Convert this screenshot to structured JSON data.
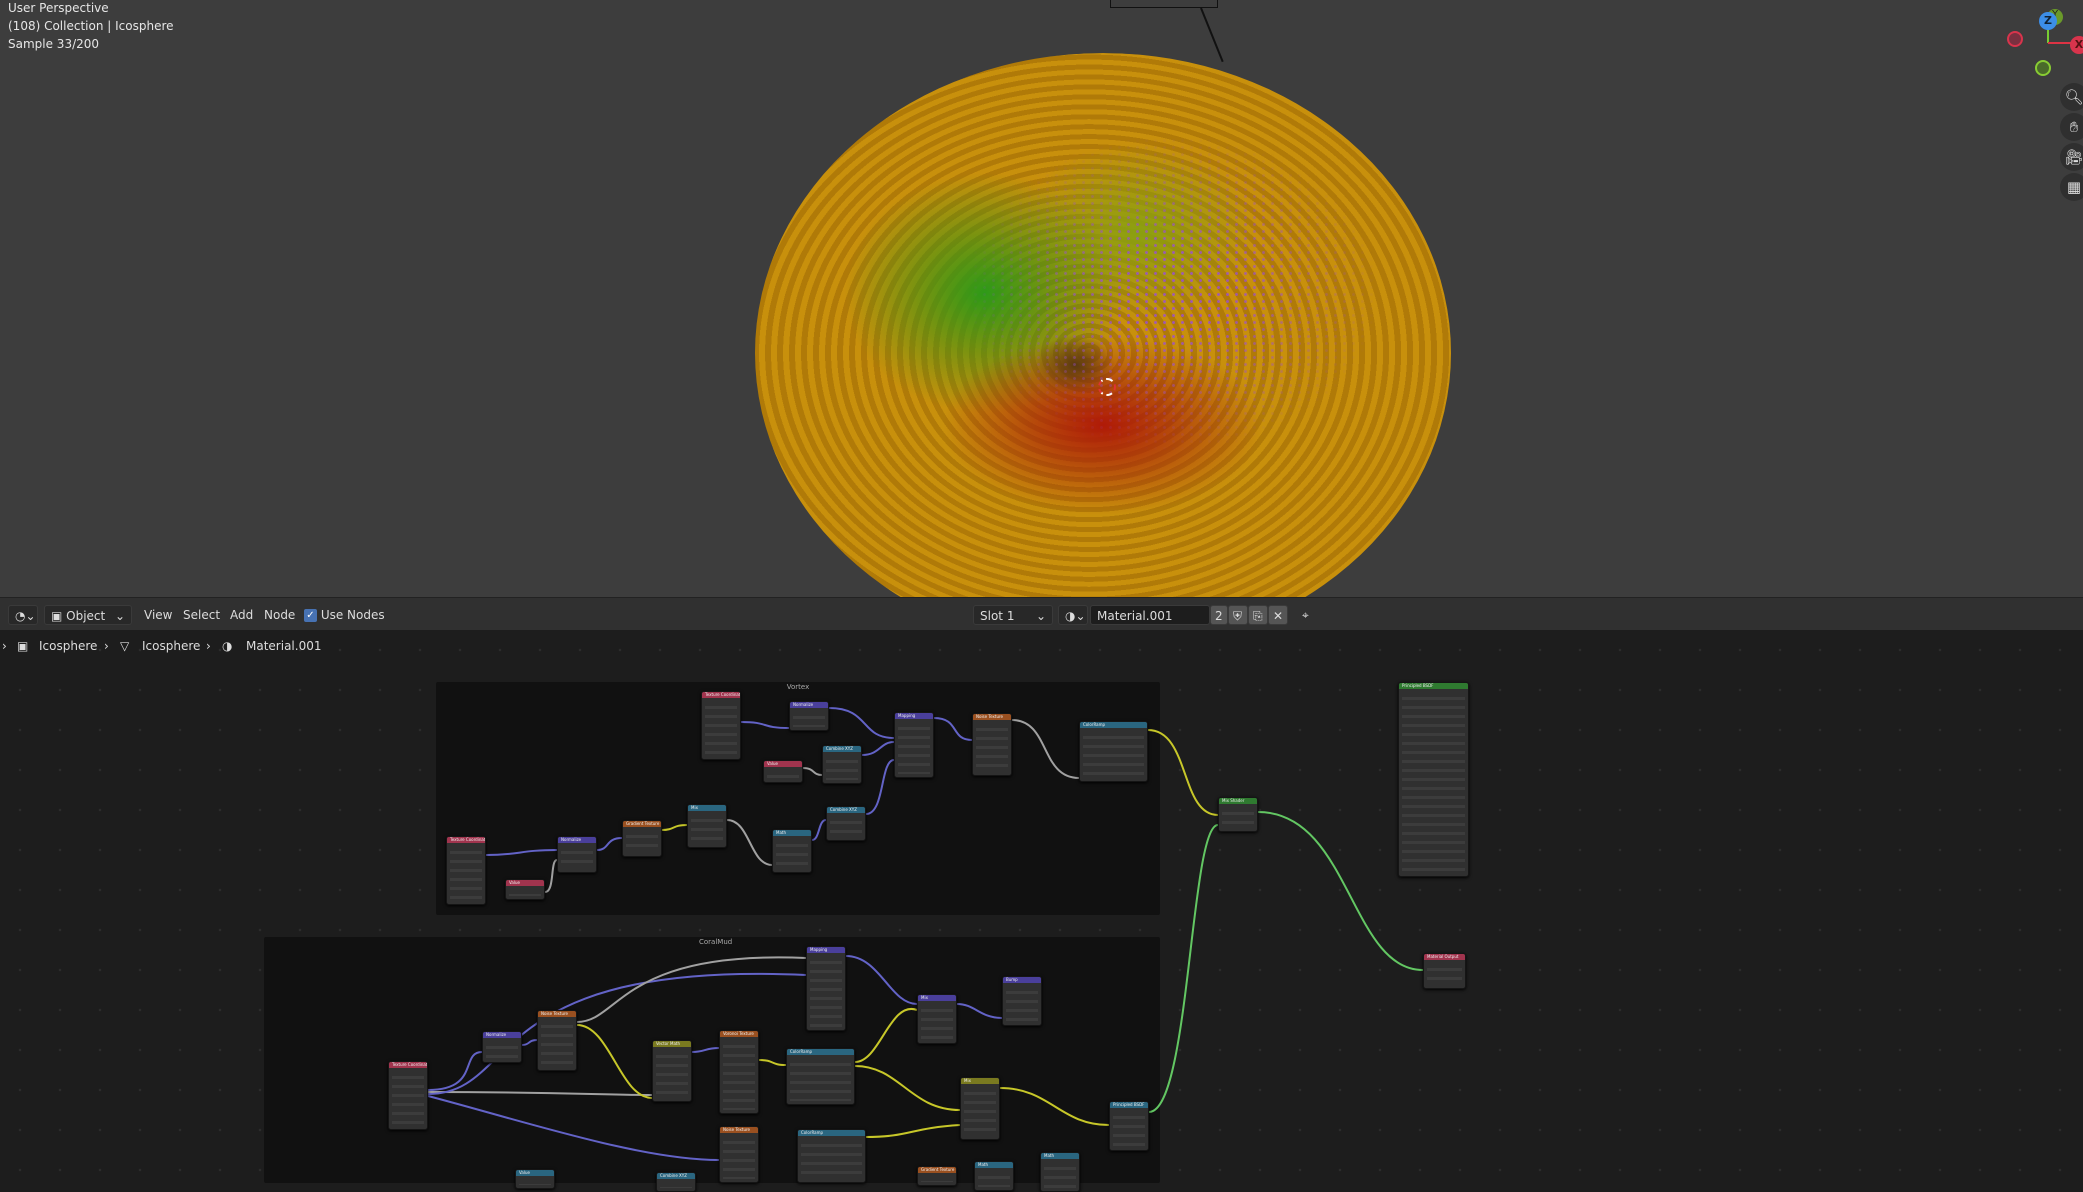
{
  "viewport": {
    "mode": "User Perspective",
    "collection": "(108) Collection | Icosphere",
    "sample": "Sample 33/200",
    "gizmo": {
      "x": "X",
      "y": "Y",
      "z": "Z"
    },
    "nav_icons": [
      "zoom-icon",
      "hand-pan-icon",
      "camera-icon",
      "grid-ortho-icon"
    ]
  },
  "header": {
    "editor_type_icon": "shader-editor-icon",
    "object_mode": "Object",
    "menus": [
      "View",
      "Select",
      "Add",
      "Node"
    ],
    "use_nodes_label": "Use Nodes",
    "use_nodes_checked": true,
    "slot": "Slot 1",
    "material": "Material.001",
    "users": "2"
  },
  "breadcrumb": [
    "Icosphere",
    "Icosphere",
    "Material.001"
  ],
  "frames": {
    "vortex": "Vortex",
    "coralmud": "CoralMud"
  },
  "nodes": [
    {
      "title": "Texture Coordinate",
      "color": "#a1344e"
    },
    {
      "title": "Normalize",
      "color": "#4a3f9b"
    },
    {
      "title": "Mapping",
      "color": "#4a3f9b"
    },
    {
      "title": "Noise Texture",
      "color": "#9a5020"
    },
    {
      "title": "ColorRamp",
      "color": "#2a6680"
    },
    {
      "title": "Value",
      "color": "#a1344e"
    },
    {
      "title": "Combine XYZ",
      "color": "#2a6680"
    },
    {
      "title": "Texture Coordinate",
      "color": "#a1344e"
    },
    {
      "title": "Value",
      "color": "#a1344e"
    },
    {
      "title": "Normalize",
      "color": "#4a3f9b"
    },
    {
      "title": "Gradient Texture",
      "color": "#9a5020"
    },
    {
      "title": "Mix",
      "color": "#2a6680"
    },
    {
      "title": "Math",
      "color": "#2a6680"
    },
    {
      "title": "Combine XYZ",
      "color": "#2a6680"
    },
    {
      "title": "Mix Shader",
      "color": "#2f7a30"
    },
    {
      "title": "Texture Coordinate",
      "color": "#a1344e"
    },
    {
      "title": "Normalize",
      "color": "#4a3f9b"
    },
    {
      "title": "Noise Texture",
      "color": "#9a5020"
    },
    {
      "title": "Mapping",
      "color": "#4a3f9b"
    },
    {
      "title": "Vector Math",
      "color": "#7a7a20"
    },
    {
      "title": "Voronoi Texture",
      "color": "#9a5020"
    },
    {
      "title": "ColorRamp",
      "color": "#2a6680"
    },
    {
      "title": "Mix",
      "color": "#4a3f9b"
    },
    {
      "title": "Bump",
      "color": "#4a3f9b"
    },
    {
      "title": "Mix",
      "color": "#7a7a20"
    },
    {
      "title": "Principled BSDF",
      "color": "#2a6680"
    },
    {
      "title": "Noise Texture",
      "color": "#9a5020"
    },
    {
      "title": "ColorRamp",
      "color": "#2a6680"
    },
    {
      "title": "Value",
      "color": "#2a6680"
    },
    {
      "title": "Combine XYZ",
      "color": "#2a6680"
    },
    {
      "title": "Gradient Texture",
      "color": "#9a5020"
    },
    {
      "title": "Math",
      "color": "#2a6680"
    },
    {
      "title": "Math",
      "color": "#2a6680"
    },
    {
      "title": "Principled BSDF",
      "color": "#2f7a30"
    },
    {
      "title": "Material Output",
      "color": "#a1344e"
    }
  ]
}
